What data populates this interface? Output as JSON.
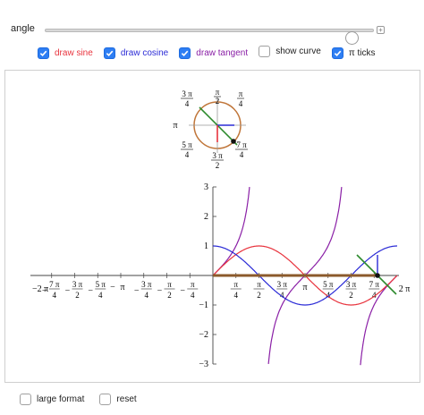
{
  "slider": {
    "label": "angle",
    "value_fraction": 0.935,
    "plus_icon": "plus-icon"
  },
  "controls": [
    {
      "id": "draw-sine",
      "label": "draw sine",
      "checked": true,
      "color": "#e8333d"
    },
    {
      "id": "draw-cosine",
      "label": "draw cosine",
      "checked": true,
      "color": "#2b2bd6"
    },
    {
      "id": "draw-tangent",
      "label": "draw tangent",
      "checked": true,
      "color": "#8a1fa6"
    },
    {
      "id": "show-curve",
      "label": "show curve",
      "checked": false,
      "color": "#222222"
    },
    {
      "id": "pi-ticks",
      "label": "π ticks",
      "checked": true,
      "color": "#222222"
    }
  ],
  "unit_circle": {
    "labels": {
      "pi_over_2": {
        "num": "π",
        "den": "2"
      },
      "three_pi_over_4": {
        "num": "3 π",
        "den": "4"
      },
      "pi_over_4": {
        "num": "π",
        "den": "4"
      },
      "pi": {
        "text": "π"
      },
      "five_pi_over_4": {
        "num": "5 π",
        "den": "4"
      },
      "three_pi_over_2": {
        "num": "3 π",
        "den": "2"
      },
      "seven_pi_over_4": {
        "num": "7 π",
        "den": "4"
      }
    }
  },
  "graph": {
    "y_ticks": [
      "3",
      "2",
      "1",
      "−1",
      "−2",
      "−3"
    ],
    "x_ticks_neg": [
      {
        "sign": "−",
        "num": "7 π",
        "den": "4"
      },
      {
        "sign": "−",
        "num": "3 π",
        "den": "2"
      },
      {
        "sign": "−",
        "num": "5 π",
        "den": "4"
      },
      {
        "sign": "−",
        "text": "π"
      },
      {
        "sign": "−",
        "num": "3 π",
        "den": "4"
      },
      {
        "sign": "−",
        "num": "π",
        "den": "2"
      },
      {
        "sign": "−",
        "num": "π",
        "den": "4"
      }
    ],
    "x_ticks_pos": [
      {
        "num": "π",
        "den": "4"
      },
      {
        "num": "π",
        "den": "2"
      },
      {
        "num": "3 π",
        "den": "4"
      },
      {
        "text": "π"
      },
      {
        "num": "5 π",
        "den": "4"
      },
      {
        "num": "3 π",
        "den": "2"
      },
      {
        "num": "7 π",
        "den": "4"
      }
    ],
    "x_min_label": "−2 π",
    "x_max_label": "2 π"
  },
  "bottom": [
    {
      "id": "large-format",
      "label": "large format",
      "checked": false
    },
    {
      "id": "reset",
      "label": "reset",
      "checked": false
    }
  ],
  "colors": {
    "sine": "#e8333d",
    "cosine": "#2b2bd6",
    "tangent": "#8a1fa6",
    "circle": "#c0763a",
    "angle_line": "#2e8b2e",
    "axis_bar": "#8b5a2b"
  }
}
